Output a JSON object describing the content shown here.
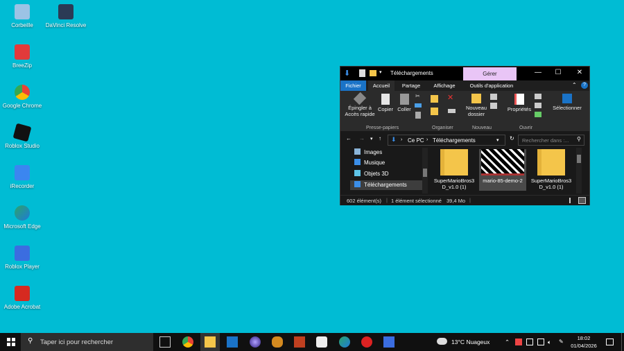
{
  "desktop_icons": [
    {
      "label": "Corbeille",
      "icon": "recycle-bin-icon",
      "color": "#8fb4d6"
    },
    {
      "label": "DaVinci Resolve",
      "icon": "davinci-resolve-icon",
      "color": "#2b3a55"
    },
    {
      "label": "BreeZip",
      "icon": "breezip-icon",
      "color": "#e23a3a"
    },
    {
      "label": "Google Chrome",
      "icon": "chrome-icon",
      "color": "#e94235"
    },
    {
      "label": "Roblox Studio",
      "icon": "roblox-studio-icon",
      "color": "#111111"
    },
    {
      "label": "iRecorder",
      "icon": "irecorder-icon",
      "color": "#3b86f0"
    },
    {
      "label": "Microsoft Edge",
      "icon": "edge-icon",
      "color": "#2aa56b"
    },
    {
      "label": "Roblox Player",
      "icon": "roblox-player-icon",
      "color": "#3b6de0"
    },
    {
      "label": "Adobe Acrobat",
      "icon": "acrobat-icon",
      "color": "#d62a20"
    }
  ],
  "explorer": {
    "title": "Téléchargements",
    "context_tab": "Gérer",
    "tabs": {
      "fichier": "Fichier",
      "accueil": "Accueil",
      "partage": "Partage",
      "affichage": "Affichage",
      "outils": "Outils d'application"
    },
    "ribbon": {
      "pin": "Épingler à Accès rapide",
      "copy": "Copier",
      "paste": "Coller",
      "new_folder": "Nouveau dossier",
      "properties": "Propriétés",
      "select": "Sélectionner",
      "groups": {
        "clipboard": "Presse-papiers",
        "organize": "Organiser",
        "new": "Nouveau",
        "open": "Ouvrir"
      }
    },
    "address": {
      "part1": "Ce PC",
      "part2": "Téléchargements"
    },
    "search_placeholder": "Rechercher dans :...",
    "nav_items": [
      "Images",
      "Musique",
      "Objets 3D",
      "Téléchargements"
    ],
    "files": [
      {
        "name": "SuperMarioBros3D_v1.0 (1)",
        "kind": "folder"
      },
      {
        "name": "mario-85-demo-2",
        "kind": "image"
      },
      {
        "name": "SuperMarioBros3D_v1.0 (1)",
        "kind": "zip"
      }
    ],
    "status": {
      "count": "602 élément(s)",
      "selected": "1 élément sélectionné",
      "size": "39,4 Mo"
    }
  },
  "taskbar": {
    "search_placeholder": "Taper ici pour rechercher",
    "weather": "13°C  Nuageux",
    "time": "18:02",
    "date": "01/04/2026",
    "accent": "#00bcd4"
  }
}
